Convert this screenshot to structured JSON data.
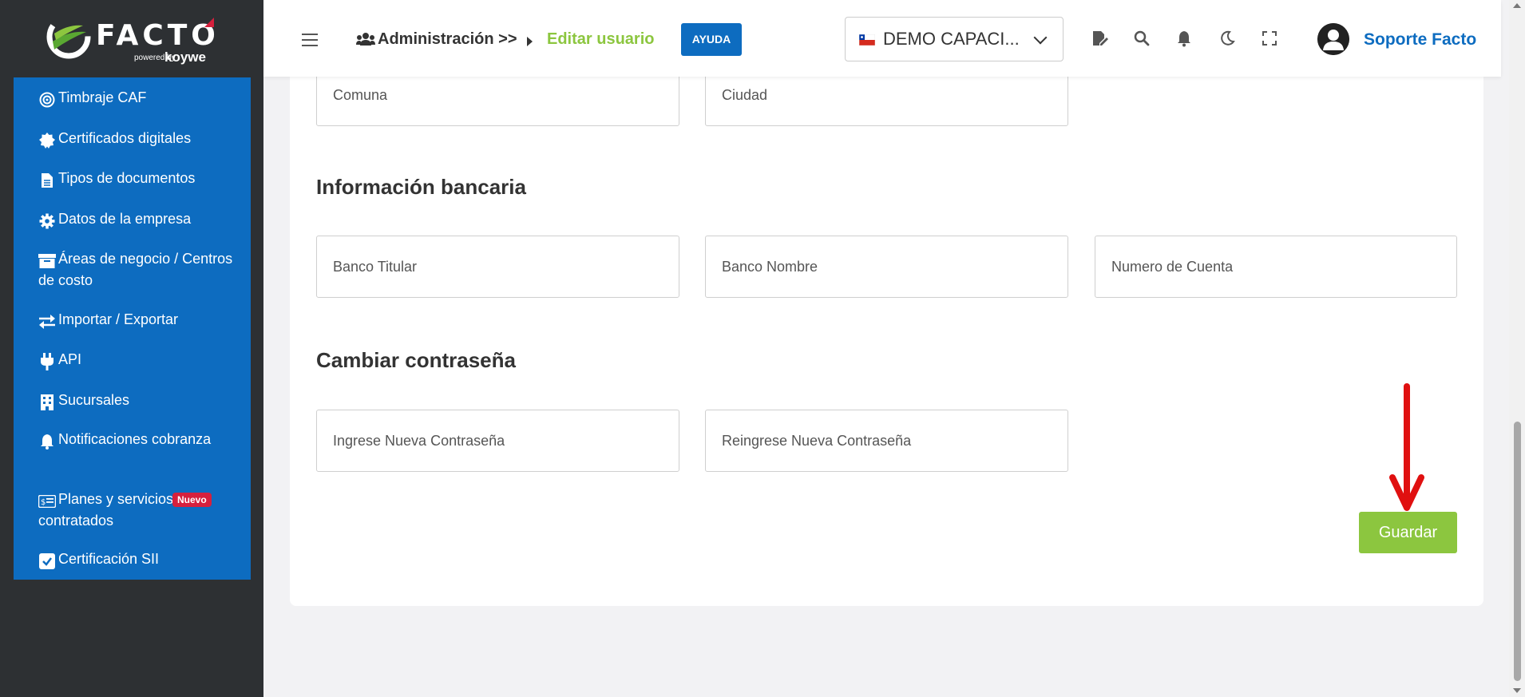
{
  "brand": {
    "name": "FACTO",
    "powered": "powered by",
    "partner": "koywe"
  },
  "sidebar": {
    "items": [
      {
        "label": "Timbraje CAF",
        "icon": "target-icon"
      },
      {
        "label": "Certificados digitales",
        "icon": "badge-icon"
      },
      {
        "label": "Tipos de documentos",
        "icon": "document-icon"
      },
      {
        "label": "Datos de la empresa",
        "icon": "gear-icon"
      },
      {
        "label": "Áreas de negocio / Centros de costo",
        "icon": "archive-icon"
      },
      {
        "label": "Importar / Exportar",
        "icon": "swap-icon"
      },
      {
        "label": "API",
        "icon": "plug-icon"
      },
      {
        "label": "Sucursales",
        "icon": "building-icon"
      },
      {
        "label": "Notificaciones cobranza",
        "icon": "bell-icon"
      },
      {
        "label": "Planes y servicios contratados",
        "icon": "money-icon",
        "badge": "Nuevo"
      },
      {
        "label": "Certificación SII",
        "icon": "checkbox-icon"
      }
    ]
  },
  "header": {
    "breadcrumb_parent": "Administración >>",
    "breadcrumb_current": "Editar usuario",
    "help_button": "AYUDA",
    "company_selector": "DEMO CAPACI...",
    "user_name": "Soporte Facto"
  },
  "form": {
    "address": {
      "comuna_placeholder": "Comuna",
      "ciudad_placeholder": "Ciudad"
    },
    "bank_section_title": "Información bancaria",
    "bank": {
      "titular_placeholder": "Banco Titular",
      "nombre_placeholder": "Banco Nombre",
      "cuenta_placeholder": "Numero de Cuenta"
    },
    "password_section_title": "Cambiar contraseña",
    "password": {
      "new_placeholder": "Ingrese Nueva Contraseña",
      "repeat_placeholder": "Reingrese Nueva Contraseña"
    },
    "save_button": "Guardar"
  },
  "colors": {
    "sidebar_bg": "#2d3033",
    "menu_blue": "#0d6cc0",
    "accent_green": "#8cc63f",
    "badge_red": "#d6203d",
    "annotation_arrow": "#e01010"
  }
}
